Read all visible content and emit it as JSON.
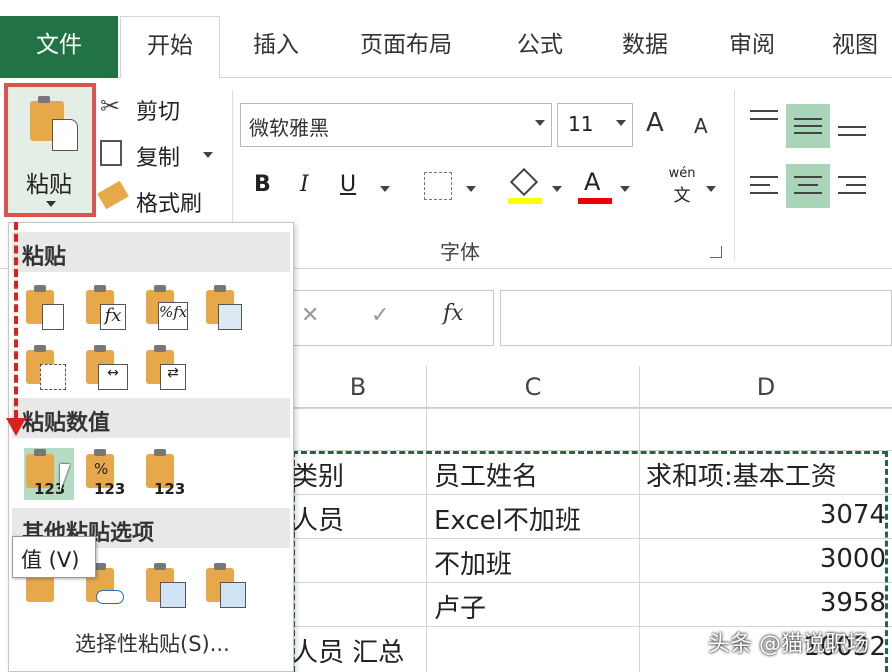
{
  "tabs": [
    "文件",
    "开始",
    "插入",
    "页面布局",
    "公式",
    "数据",
    "审阅",
    "视图"
  ],
  "clipboard": {
    "paste": "粘贴",
    "cut": "剪切",
    "copy": "复制",
    "format_painter": "格式刷"
  },
  "font": {
    "name": "微软雅黑",
    "size": "11",
    "group": "字体",
    "bold": "B",
    "italic": "I",
    "underline": "U",
    "font_color_label": "A",
    "grow": "A",
    "shrink": "A",
    "phonetic_top": "wén",
    "phonetic_bottom": "文"
  },
  "formula_bar": {
    "cancel": "✕",
    "enter": "✓",
    "fx": "fx"
  },
  "columns": [
    "B",
    "C",
    "D"
  ],
  "rows": [
    {
      "b": "类别",
      "c": "员工姓名",
      "d": "求和项:基本工资"
    },
    {
      "b": "人员",
      "c": "Excel不加班",
      "d": "3074"
    },
    {
      "b": "",
      "c": "不加班",
      "d": "3000"
    },
    {
      "b": "",
      "c": "卢子",
      "d": "3958"
    },
    {
      "b": "人员 汇总",
      "c": "",
      "d": "10032"
    }
  ],
  "paste_menu": {
    "section1": "粘贴",
    "section2": "粘贴数值",
    "section3": "其他粘贴选项",
    "footer": "选择性粘贴(S)...",
    "tooltip": "值 (V)",
    "num": "123"
  },
  "watermark": "头条 @猫说职场",
  "colors": {
    "accent": "#217346",
    "highlight": "#d9534f",
    "selected": "#a8d5b8"
  }
}
